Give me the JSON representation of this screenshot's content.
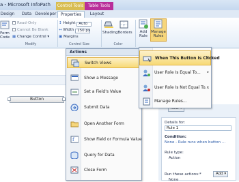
{
  "window": {
    "title": "a - Microsoft InfoPath",
    "context_tabs": [
      "Control Tools",
      "Table Tools"
    ]
  },
  "tabs": [
    {
      "label": "Design",
      "active": false
    },
    {
      "label": "Data",
      "active": false
    },
    {
      "label": "Developer",
      "active": false
    },
    {
      "label": "Properties",
      "active": true
    },
    {
      "label": "Layout",
      "active": false
    }
  ],
  "ribbon": {
    "form_code_label": "Form",
    "form_code_label2": "Code",
    "read_only": "Read-Only",
    "cannot_be_blank": "Cannot Be Blank",
    "change_control": "Change Control",
    "group_modify": "Modify",
    "height_label": "Height",
    "height_value": "Auto",
    "width_label": "Width",
    "width_value": "150 px",
    "margins_label": "Margins",
    "group_size": "Control Size",
    "shading_label": "Shading",
    "borders_label": "Borders",
    "group_color": "Color",
    "add_rule_label": "Add",
    "add_rule_label2": "Rule",
    "manage_rules_label": "Manage",
    "manage_rules_label2": "Rules"
  },
  "form": {
    "button_label": "Button"
  },
  "actions_menu": {
    "header": "Actions",
    "items": [
      {
        "label": "Switch Views",
        "icon": "switch-views-icon",
        "highlighted": true
      },
      {
        "label": "Show a Message",
        "icon": "message-icon",
        "highlighted": false
      },
      {
        "label": "Set a Field's Value",
        "icon": "set-field-icon",
        "highlighted": false
      },
      {
        "label": "Submit Data",
        "icon": "submit-icon",
        "highlighted": false
      },
      {
        "label": "Open Another Form",
        "icon": "open-form-icon",
        "highlighted": false
      },
      {
        "label": "Show Field or Formula Value",
        "icon": "formula-icon",
        "highlighted": false
      },
      {
        "label": "Query for Data",
        "icon": "query-icon",
        "highlighted": false
      },
      {
        "label": "Close Form",
        "icon": "close-form-icon",
        "highlighted": false
      }
    ]
  },
  "condition_menu": {
    "items": [
      {
        "label": "When This Button Is Clicked",
        "highlighted": true,
        "has_arrow": true
      },
      {
        "label": "User Role Is Equal To...",
        "highlighted": false,
        "has_arrow": true
      },
      {
        "label": "User Role Is Not Equal To...",
        "highlighted": false,
        "has_arrow": true
      },
      {
        "label": "Manage Rules...",
        "highlighted": false,
        "has_arrow": false
      }
    ]
  },
  "rules_pane": {
    "new_button": "New",
    "details_for": "Details for:",
    "rule_name": "Rule 1",
    "condition_label": "Condition:",
    "condition_value": "None - Rule runs when button ...",
    "rule_type_label": "Rule type:",
    "rule_type_value": "Action",
    "run_actions_label": "Run these actions:*",
    "add_button": "Add",
    "actions_value": "None"
  },
  "colors": {
    "highlight": "#f7d976",
    "context_control": "#d8bd52",
    "context_table": "#b92e9a"
  }
}
